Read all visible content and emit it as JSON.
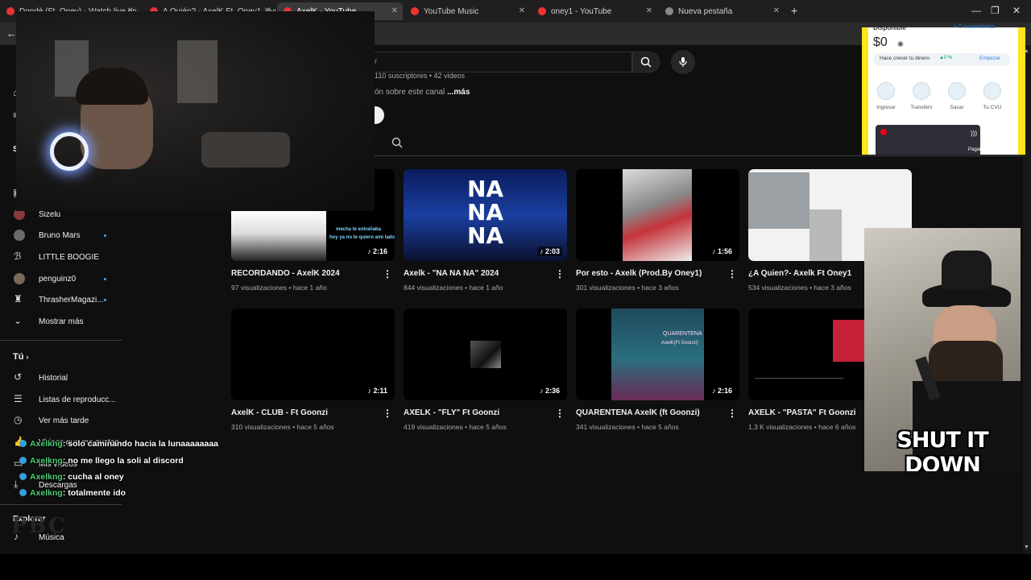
{
  "browser": {
    "tabs": [
      {
        "title": "Dondé (Ft. Oney) - Watch live on..."
      },
      {
        "title": "A Quién? - AxelK Ft. Oney1 - lyri..."
      },
      {
        "title": "AxelK - YouTube"
      },
      {
        "title": "YouTube Music"
      },
      {
        "title": "oney1 - YouTube"
      },
      {
        "title": "Nueva pestaña"
      }
    ],
    "new_tab": "+"
  },
  "channel": {
    "stats": "110 suscriptores • 42 videos",
    "about_prefix": "ón sobre este canal",
    "about_more": "...más",
    "search_placeholder": "r"
  },
  "sidebar": {
    "subscriptions": [
      {
        "label": "Sizelu",
        "icon": "avatar-icon",
        "dot": false
      },
      {
        "label": "Bruno Mars",
        "icon": "avatar-icon",
        "dot": true
      },
      {
        "label": "LITTLE BOOGIE",
        "icon": "avatar-icon",
        "dot": false
      },
      {
        "label": "penguinz0",
        "icon": "avatar-icon",
        "dot": true
      },
      {
        "label": "ThrasherMagazi...",
        "icon": "avatar-icon",
        "dot": true
      }
    ],
    "show_more": "Mostrar más",
    "you_heading": "Tú",
    "you_items": [
      {
        "label": "Historial",
        "icon": "history-icon"
      },
      {
        "label": "Listas de reproducc...",
        "icon": "playlist-icon"
      },
      {
        "label": "Ver más tarde",
        "icon": "clock-icon"
      },
      {
        "label": "Vídeos que me gustan",
        "icon": "thumb-up-icon"
      },
      {
        "label": "Mis vídeos",
        "icon": "video-icon"
      },
      {
        "label": "Descargas",
        "icon": "download-icon"
      }
    ],
    "explore_heading": "Explorar",
    "music": "Música",
    "partial_letter": "S"
  },
  "videos": [
    {
      "title": "RECORDANDO - AxelK 2024",
      "views": "97 visualizaciones",
      "age": "hace 1 año",
      "duration": "2:16",
      "thumb_text": [
        "mecha te extrañaba",
        "hoy ya no te quiero ami lado"
      ]
    },
    {
      "title": "Axelk - \"NA NA NA\" 2024",
      "views": "844 visualizaciones",
      "age": "hace 1 año",
      "duration": "2:03",
      "thumb_text": [
        "NA",
        "NA",
        "NA"
      ]
    },
    {
      "title": "Por esto - Axelk (Prod.By Oney1)",
      "views": "301 visualizaciones",
      "age": "hace 3 años",
      "duration": "1:56",
      "thumb_text": []
    },
    {
      "title": "¿A Quien?- Axelk Ft Oney1",
      "views": "534 visualizaciones",
      "age": "hace 3 años",
      "duration": "",
      "thumb_text": []
    },
    {
      "title": "AxelK - CLUB - Ft Goonzi",
      "views": "310 visualizaciones",
      "age": "hace 5 años",
      "duration": "2:11",
      "thumb_text": []
    },
    {
      "title": "AXELK - \"FLY\" Ft Goonzi",
      "views": "419 visualizaciones",
      "age": "hace 5 años",
      "duration": "2:36",
      "thumb_text": []
    },
    {
      "title": "QUARENTENA AxelK (ft Goonzi)",
      "views": "341 visualizaciones",
      "age": "hace 5 años",
      "duration": "2:16",
      "thumb_text": [
        "QUARENTENA",
        "AxelK(Ft Goonzi)"
      ]
    },
    {
      "title": "AXELK - \"PASTA\" Ft Goonzi",
      "views": "1,3 K visualizaciones",
      "age": "hace 6 años",
      "duration": "",
      "thumb_text": []
    }
  ],
  "chat": [
    {
      "user": "Axelkng",
      "message": ": solo caminando hacia la lunaaaaaaaa"
    },
    {
      "user": "Axelkng",
      "message": ": no me llego la soli al discord"
    },
    {
      "user": "Axelkng",
      "message": ": cucha al oney"
    },
    {
      "user": "Axelkng",
      "message": ": totalmente ido"
    }
  ],
  "wallet": {
    "header": "Disponible",
    "movements": "> 0 movimientos",
    "balance": "$0",
    "grow_text": "Hace crecer tu dinero",
    "rate": "▲0 %",
    "invest": "Empezar",
    "actions": [
      "Ingresar",
      "Transferir",
      "Sacar",
      "Tu CVU"
    ],
    "pay": "Pagar"
  },
  "meme": {
    "caption": "SHUT IT DOWN"
  },
  "watermark": "PBC",
  "colors": {
    "accent": "#3ea6ff",
    "chat_user": "#4fd17a",
    "wallet_yellow": "#ffe51a",
    "yt_red": "#ff0033"
  }
}
